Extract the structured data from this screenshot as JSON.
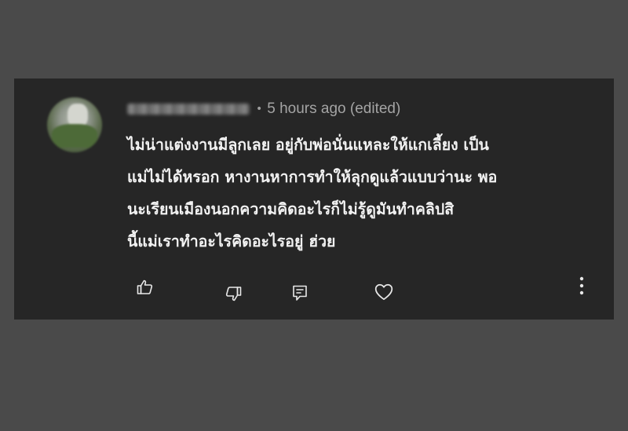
{
  "comment": {
    "meta": "5 hours ago (edited)",
    "separator": "•",
    "text_lines": [
      "ไม่น่าแต่งงานมีลูกเลย อยู่กับพ่อนั่นแหละให้แกเลี้ยง เป็น",
      "แม่ไม่ได้หรอก หางานหาการทำให้ลุกดูแล้วแบบว่านะ พอ",
      "นะเรียนเมืองนอกความคิดอะไรก็ไม่รู้ดูมันทำคลิปสิ",
      "นี้แม่เราทำอะไรคิดอะไรอยู่ ฮ่วย"
    ]
  },
  "actions": {
    "like_icon": "thumbs-up-icon",
    "dislike_icon": "thumbs-down-icon",
    "reply_icon": "reply-icon",
    "heart_icon": "heart-icon",
    "more_icon": "more-vertical-icon"
  },
  "colors": {
    "background": "#4a4a4a",
    "card": "#262626",
    "text": "#f2f2f2",
    "meta": "#a4a4a4"
  }
}
